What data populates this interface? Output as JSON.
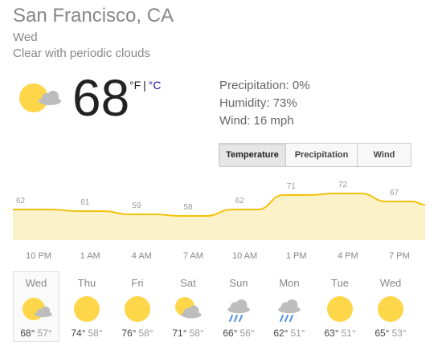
{
  "location": "San Francisco, CA",
  "day": "Wed",
  "condition": "Clear with periodic clouds",
  "current": {
    "temp": "68",
    "icon": "sun-cloud-icon",
    "unit_f": "°F",
    "unit_sep": "|",
    "unit_c": "°C"
  },
  "details": {
    "precipitation": "Precipitation: 0%",
    "humidity": "Humidity: 73%",
    "wind": "Wind: 16 mph"
  },
  "tabs": [
    {
      "label": "Temperature",
      "active": true
    },
    {
      "label": "Precipitation",
      "active": false
    },
    {
      "label": "Wind",
      "active": false
    }
  ],
  "chart_data": {
    "type": "area",
    "x": [
      "10 PM",
      "1 AM",
      "4 AM",
      "7 AM",
      "10 AM",
      "1 PM",
      "4 PM",
      "7 PM"
    ],
    "values": [
      62,
      61,
      59,
      58,
      62,
      71,
      72,
      67
    ],
    "y_unit": "°F"
  },
  "forecast": [
    {
      "day": "Wed",
      "icon": "sun-cloud-icon",
      "high": "68°",
      "low": "57°",
      "selected": true
    },
    {
      "day": "Thu",
      "icon": "sun-icon",
      "high": "74°",
      "low": "58°"
    },
    {
      "day": "Fri",
      "icon": "sun-icon",
      "high": "76°",
      "low": "58°"
    },
    {
      "day": "Sat",
      "icon": "partly-cloudy-icon",
      "high": "71°",
      "low": "58°"
    },
    {
      "day": "Sun",
      "icon": "rain-cloud-icon",
      "high": "66°",
      "low": "56°"
    },
    {
      "day": "Mon",
      "icon": "rain-cloud-icon",
      "high": "62°",
      "low": "51°"
    },
    {
      "day": "Tue",
      "icon": "sun-icon",
      "high": "63°",
      "low": "51°"
    },
    {
      "day": "Wed",
      "icon": "sun-icon",
      "high": "65°",
      "low": "53°"
    }
  ],
  "colors": {
    "line": "#f4c20d",
    "fill": "#fcf2c9",
    "sun": "#fdd64a",
    "cloud": "#bdbdbd",
    "rain": "#4a90e2",
    "link": "#1a0dab"
  }
}
